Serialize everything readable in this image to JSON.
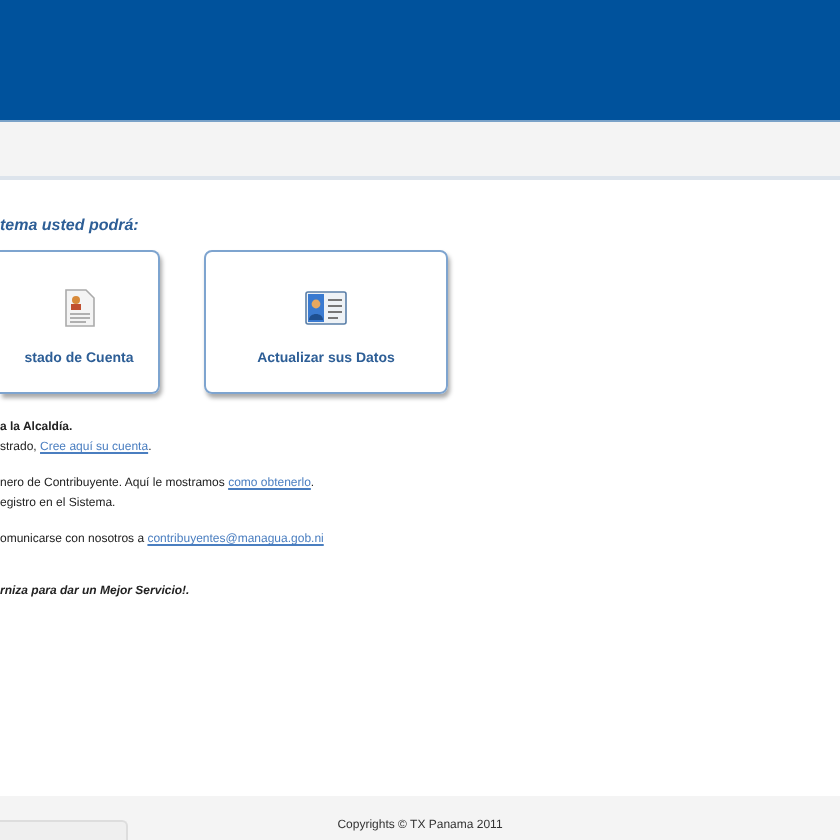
{
  "heading": "tema usted podrá:",
  "cards": [
    {
      "label": "stado de Cuenta",
      "kind": "document"
    },
    {
      "label": "Actualizar sus Datos",
      "kind": "profile"
    }
  ],
  "lines": [
    {
      "kind": "bold",
      "before": "a la Alcaldía."
    },
    {
      "kind": "plain",
      "before": "strado, ",
      "link": "Cree aquí su cuenta",
      "after": "."
    },
    {
      "kind": "gap"
    },
    {
      "kind": "plain",
      "before": "nero de Contribuyente. Aquí le mostramos ",
      "link": "como obtenerlo",
      "after": "."
    },
    {
      "kind": "plain",
      "before": "egistro en el Sistema."
    },
    {
      "kind": "gap"
    },
    {
      "kind": "plain",
      "before": "omunicarse con nosotros a ",
      "link": "contribuyentes@managua.gob.ni"
    },
    {
      "kind": "gap"
    },
    {
      "kind": "gap"
    },
    {
      "kind": "emphasis",
      "before": "rniza para dar un Mejor Servicio!."
    }
  ],
  "footer": {
    "copyright": "Copyrights © TX Panama 2011"
  }
}
